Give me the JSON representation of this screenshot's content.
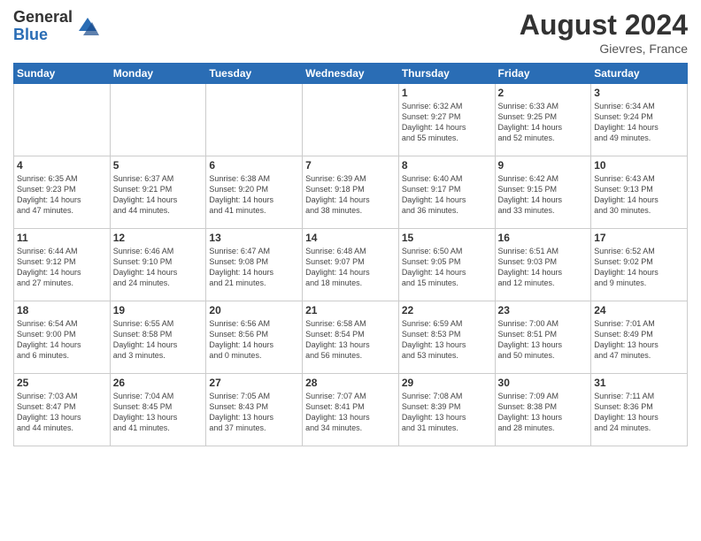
{
  "header": {
    "logo_general": "General",
    "logo_blue": "Blue",
    "month_title": "August 2024",
    "location": "Gievres, France"
  },
  "days_of_week": [
    "Sunday",
    "Monday",
    "Tuesday",
    "Wednesday",
    "Thursday",
    "Friday",
    "Saturday"
  ],
  "weeks": [
    [
      {
        "day": "",
        "info": ""
      },
      {
        "day": "",
        "info": ""
      },
      {
        "day": "",
        "info": ""
      },
      {
        "day": "",
        "info": ""
      },
      {
        "day": "1",
        "info": "Sunrise: 6:32 AM\nSunset: 9:27 PM\nDaylight: 14 hours\nand 55 minutes."
      },
      {
        "day": "2",
        "info": "Sunrise: 6:33 AM\nSunset: 9:25 PM\nDaylight: 14 hours\nand 52 minutes."
      },
      {
        "day": "3",
        "info": "Sunrise: 6:34 AM\nSunset: 9:24 PM\nDaylight: 14 hours\nand 49 minutes."
      }
    ],
    [
      {
        "day": "4",
        "info": "Sunrise: 6:35 AM\nSunset: 9:23 PM\nDaylight: 14 hours\nand 47 minutes."
      },
      {
        "day": "5",
        "info": "Sunrise: 6:37 AM\nSunset: 9:21 PM\nDaylight: 14 hours\nand 44 minutes."
      },
      {
        "day": "6",
        "info": "Sunrise: 6:38 AM\nSunset: 9:20 PM\nDaylight: 14 hours\nand 41 minutes."
      },
      {
        "day": "7",
        "info": "Sunrise: 6:39 AM\nSunset: 9:18 PM\nDaylight: 14 hours\nand 38 minutes."
      },
      {
        "day": "8",
        "info": "Sunrise: 6:40 AM\nSunset: 9:17 PM\nDaylight: 14 hours\nand 36 minutes."
      },
      {
        "day": "9",
        "info": "Sunrise: 6:42 AM\nSunset: 9:15 PM\nDaylight: 14 hours\nand 33 minutes."
      },
      {
        "day": "10",
        "info": "Sunrise: 6:43 AM\nSunset: 9:13 PM\nDaylight: 14 hours\nand 30 minutes."
      }
    ],
    [
      {
        "day": "11",
        "info": "Sunrise: 6:44 AM\nSunset: 9:12 PM\nDaylight: 14 hours\nand 27 minutes."
      },
      {
        "day": "12",
        "info": "Sunrise: 6:46 AM\nSunset: 9:10 PM\nDaylight: 14 hours\nand 24 minutes."
      },
      {
        "day": "13",
        "info": "Sunrise: 6:47 AM\nSunset: 9:08 PM\nDaylight: 14 hours\nand 21 minutes."
      },
      {
        "day": "14",
        "info": "Sunrise: 6:48 AM\nSunset: 9:07 PM\nDaylight: 14 hours\nand 18 minutes."
      },
      {
        "day": "15",
        "info": "Sunrise: 6:50 AM\nSunset: 9:05 PM\nDaylight: 14 hours\nand 15 minutes."
      },
      {
        "day": "16",
        "info": "Sunrise: 6:51 AM\nSunset: 9:03 PM\nDaylight: 14 hours\nand 12 minutes."
      },
      {
        "day": "17",
        "info": "Sunrise: 6:52 AM\nSunset: 9:02 PM\nDaylight: 14 hours\nand 9 minutes."
      }
    ],
    [
      {
        "day": "18",
        "info": "Sunrise: 6:54 AM\nSunset: 9:00 PM\nDaylight: 14 hours\nand 6 minutes."
      },
      {
        "day": "19",
        "info": "Sunrise: 6:55 AM\nSunset: 8:58 PM\nDaylight: 14 hours\nand 3 minutes."
      },
      {
        "day": "20",
        "info": "Sunrise: 6:56 AM\nSunset: 8:56 PM\nDaylight: 14 hours\nand 0 minutes."
      },
      {
        "day": "21",
        "info": "Sunrise: 6:58 AM\nSunset: 8:54 PM\nDaylight: 13 hours\nand 56 minutes."
      },
      {
        "day": "22",
        "info": "Sunrise: 6:59 AM\nSunset: 8:53 PM\nDaylight: 13 hours\nand 53 minutes."
      },
      {
        "day": "23",
        "info": "Sunrise: 7:00 AM\nSunset: 8:51 PM\nDaylight: 13 hours\nand 50 minutes."
      },
      {
        "day": "24",
        "info": "Sunrise: 7:01 AM\nSunset: 8:49 PM\nDaylight: 13 hours\nand 47 minutes."
      }
    ],
    [
      {
        "day": "25",
        "info": "Sunrise: 7:03 AM\nSunset: 8:47 PM\nDaylight: 13 hours\nand 44 minutes."
      },
      {
        "day": "26",
        "info": "Sunrise: 7:04 AM\nSunset: 8:45 PM\nDaylight: 13 hours\nand 41 minutes."
      },
      {
        "day": "27",
        "info": "Sunrise: 7:05 AM\nSunset: 8:43 PM\nDaylight: 13 hours\nand 37 minutes."
      },
      {
        "day": "28",
        "info": "Sunrise: 7:07 AM\nSunset: 8:41 PM\nDaylight: 13 hours\nand 34 minutes."
      },
      {
        "day": "29",
        "info": "Sunrise: 7:08 AM\nSunset: 8:39 PM\nDaylight: 13 hours\nand 31 minutes."
      },
      {
        "day": "30",
        "info": "Sunrise: 7:09 AM\nSunset: 8:38 PM\nDaylight: 13 hours\nand 28 minutes."
      },
      {
        "day": "31",
        "info": "Sunrise: 7:11 AM\nSunset: 8:36 PM\nDaylight: 13 hours\nand 24 minutes."
      }
    ]
  ]
}
